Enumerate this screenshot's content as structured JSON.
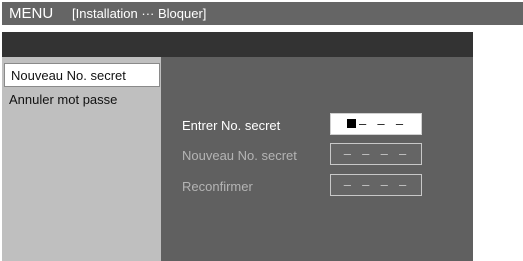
{
  "titlebar": {
    "menu_label": "MENU",
    "breadcrumb": "[Installation ··· Bloquer]"
  },
  "sidebar": {
    "items": [
      {
        "label": "Nouveau No. secret",
        "selected": true
      },
      {
        "label": "Annuler mot passe",
        "selected": false
      }
    ]
  },
  "form": {
    "rows": [
      {
        "label": "Entrer No. secret",
        "value": "– – –",
        "state": "active"
      },
      {
        "label": "Nouveau No. secret",
        "value": "– – – –",
        "state": "disabled"
      },
      {
        "label": "Reconfirmer",
        "value": "– – – –",
        "state": "disabled"
      }
    ]
  },
  "colors": {
    "titlebar_bg": "#656565",
    "panel_header_bg": "#333333",
    "sidebar_bg": "#bfbfbf",
    "content_bg": "#606060"
  }
}
